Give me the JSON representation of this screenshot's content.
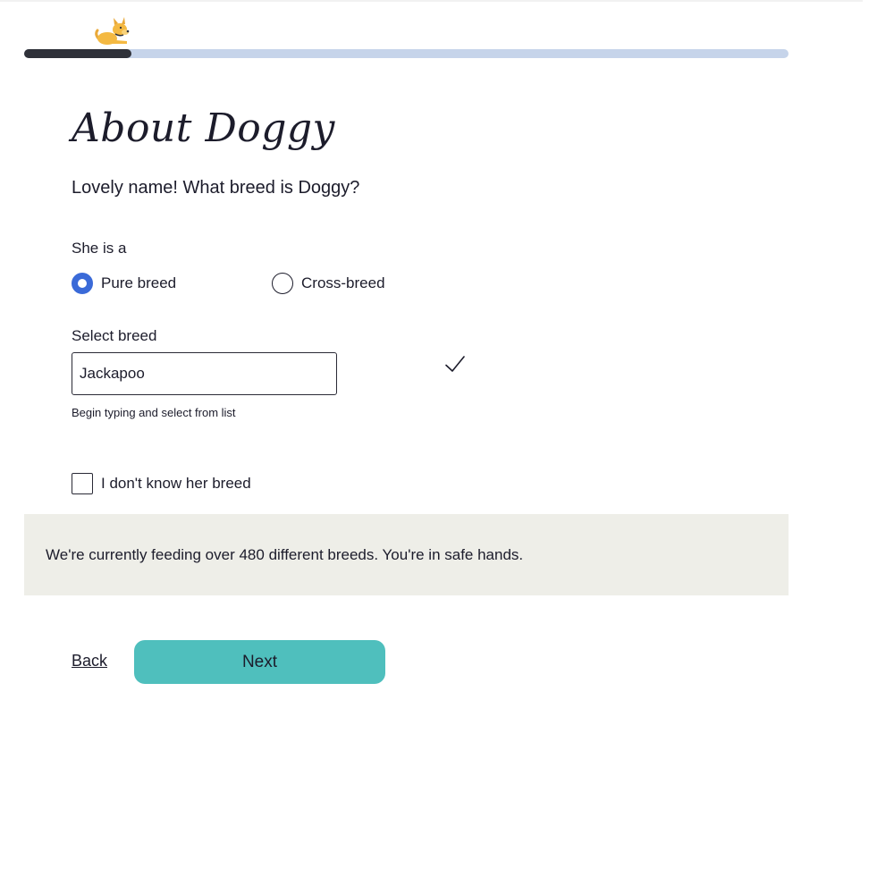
{
  "header": {
    "icon": "dog-icon",
    "progress_fraction": 0.14
  },
  "page": {
    "title": "About Doggy",
    "question": "Lovely name! What breed is Doggy?"
  },
  "breed_type": {
    "label": "She is a",
    "options": [
      {
        "label": "Pure breed",
        "checked": true
      },
      {
        "label": "Cross-breed",
        "checked": false
      }
    ]
  },
  "breed_select": {
    "label": "Select breed",
    "value": "Jackapoo",
    "hint": "Begin typing and select from list",
    "valid_icon": "checkmark-icon"
  },
  "unknown_breed": {
    "label": "I don't know her breed",
    "checked": false
  },
  "info": {
    "text": "We're currently feeding over 480 different breeds. You're in safe hands."
  },
  "footer": {
    "back_label": "Back",
    "next_label": "Next"
  },
  "colors": {
    "accent_button": "#4fbfbd",
    "radio_selected": "#3a6ad8",
    "progress_fill": "#2f3139",
    "progress_track": "#c6d4ea",
    "info_background": "#eeeee8"
  }
}
